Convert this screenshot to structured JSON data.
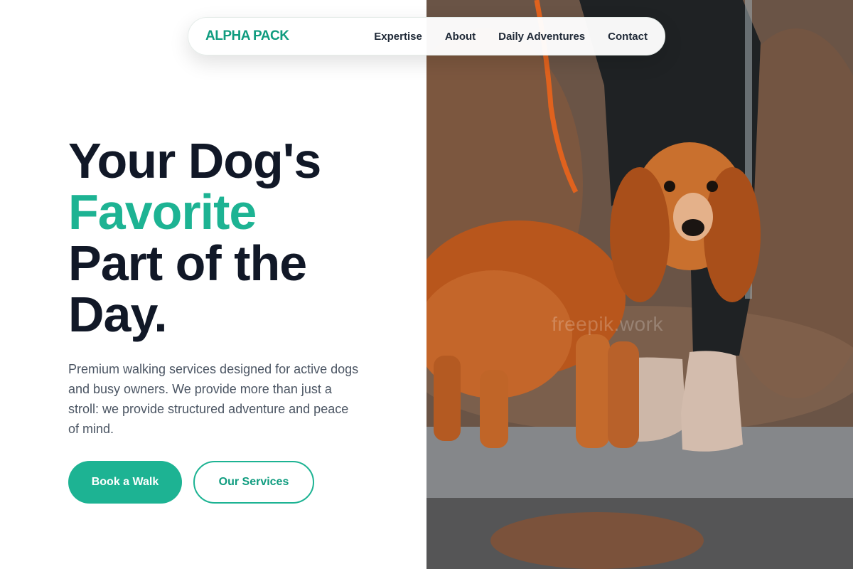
{
  "nav": {
    "brand": "ALPHA PACK",
    "links": [
      "Expertise",
      "About",
      "Daily Adventures",
      "Contact"
    ]
  },
  "hero": {
    "headline_line1": "Your Dog's",
    "headline_accent": "Favorite",
    "headline_line3": "Part of the",
    "headline_line4": "Day.",
    "lead": "Premium walking services designed for active dogs and busy owners. We provide more than just a stroll: we provide structured adventure and peace of mind.",
    "primary_button": "Book a Walk",
    "secondary_button": "Our Services",
    "photo_watermark": "freepik.work"
  },
  "colors": {
    "accent": "#1db393",
    "brand": "#0f9c7f",
    "text": "#111827",
    "muted": "#4b5563"
  }
}
